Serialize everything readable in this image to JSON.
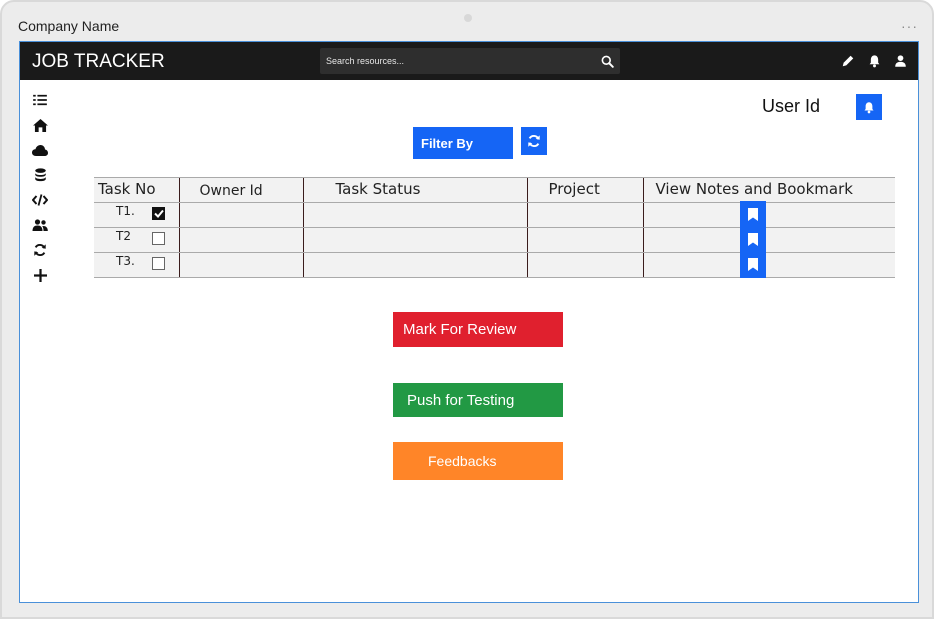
{
  "window": {
    "company_name": "Company Name",
    "menu_dots": "···"
  },
  "header": {
    "title": "JOB TRACKER",
    "search_placeholder": "Search resources...",
    "icons": [
      "search-icon",
      "pencil-icon",
      "bell-icon",
      "user-icon"
    ]
  },
  "sidebar": {
    "icons": [
      "list-icon",
      "home-icon",
      "cloud-icon",
      "database-icon",
      "code-icon",
      "users-icon",
      "refresh-icon",
      "plus-icon"
    ]
  },
  "user": {
    "label": "User Id"
  },
  "filter": {
    "label": "Filter By"
  },
  "table": {
    "headers": [
      "Task No",
      "Owner Id",
      "Task Status",
      "Project",
      "View Notes and Bookmark"
    ],
    "rows": [
      {
        "task": "T1.",
        "checked": true
      },
      {
        "task": "T2",
        "checked": false
      },
      {
        "task": "T3.",
        "checked": false
      }
    ]
  },
  "actions": {
    "review": "Mark For Review",
    "testing": "Push for Testing",
    "feedback": "Feedbacks"
  },
  "colors": {
    "accent_blue": "#1565f5",
    "review_red": "#e0202e",
    "testing_green": "#229944",
    "feedback_orange": "#ff8528",
    "topbar": "#1a1a1a"
  }
}
